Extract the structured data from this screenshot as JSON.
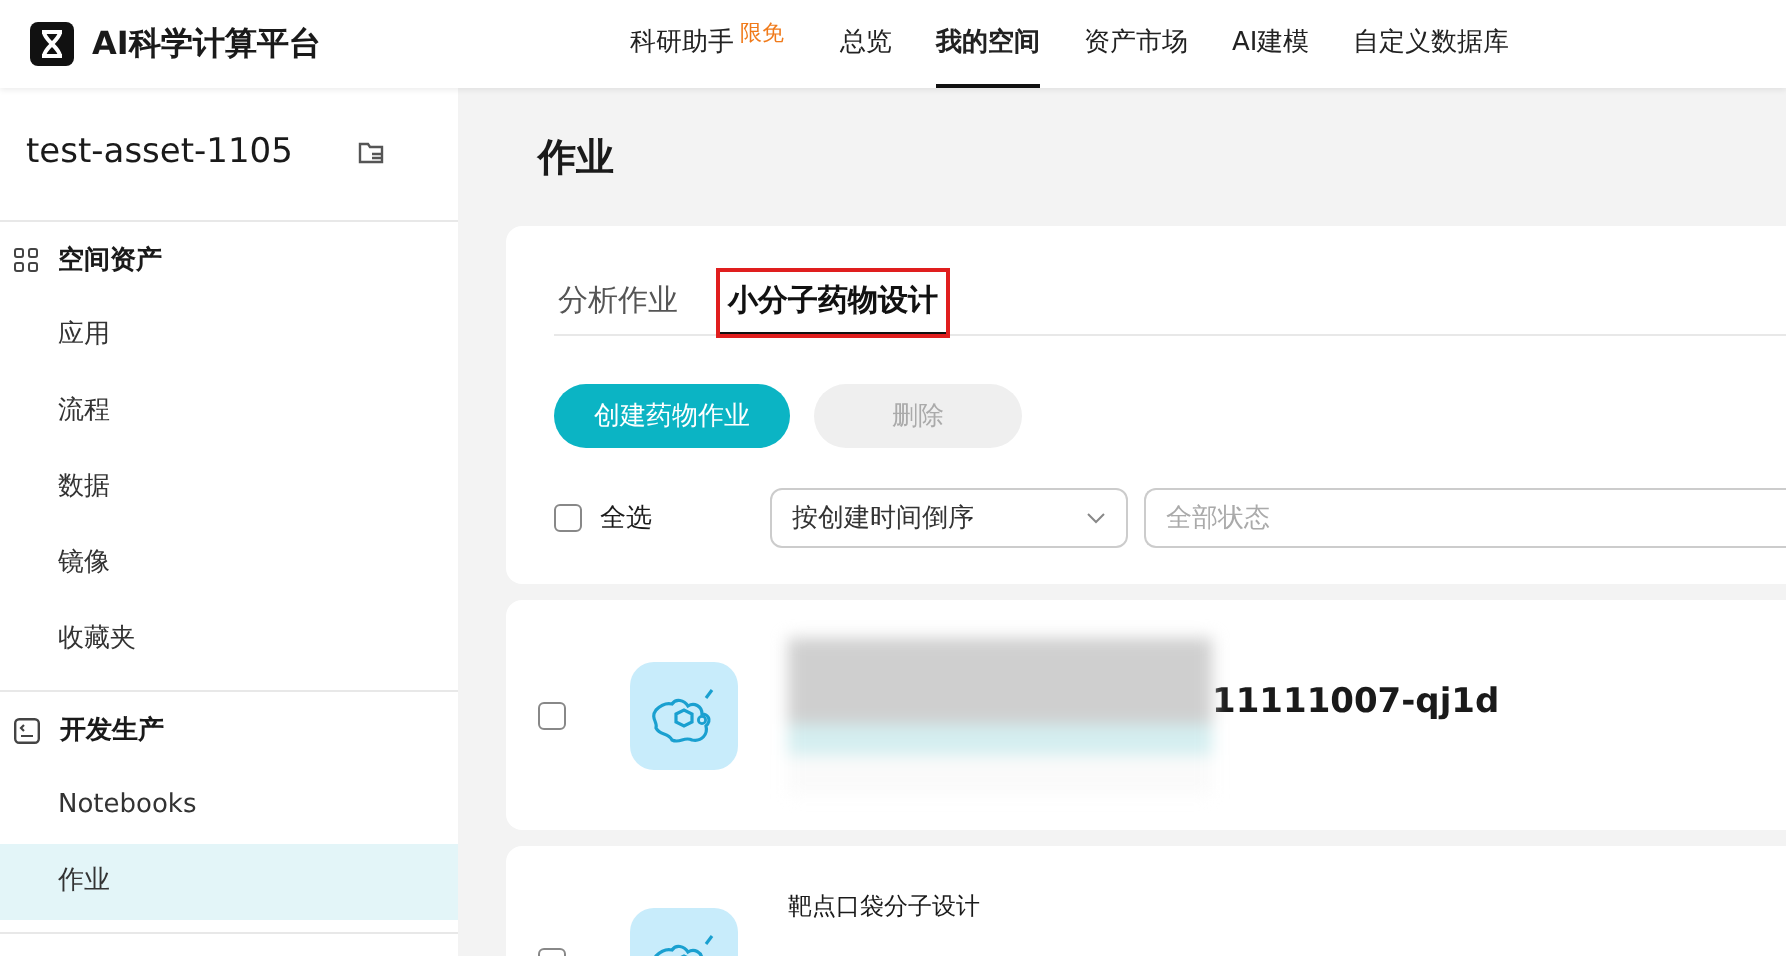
{
  "header": {
    "brand": "AI科学计算平台",
    "nav": [
      {
        "label": "科研助手",
        "badge": "限免",
        "selected": false
      },
      {
        "label": "总览",
        "selected": false
      },
      {
        "label": "我的空间",
        "selected": true
      },
      {
        "label": "资产市场",
        "selected": false
      },
      {
        "label": "AI建模",
        "selected": false
      },
      {
        "label": "自定义数据库",
        "selected": false
      }
    ]
  },
  "sidebar": {
    "workspace": "test-asset-1105",
    "groups": [
      {
        "title": "空间资产",
        "kind": "assets",
        "items": [
          {
            "label": "应用",
            "selected": false
          },
          {
            "label": "流程",
            "selected": false
          },
          {
            "label": "数据",
            "selected": false
          },
          {
            "label": "镜像",
            "selected": false
          },
          {
            "label": "收藏夹",
            "selected": false
          }
        ]
      },
      {
        "title": "开发生产",
        "kind": "development",
        "items": [
          {
            "label": "Notebooks",
            "selected": false
          },
          {
            "label": "作业",
            "selected": true
          }
        ]
      }
    ]
  },
  "page_title": "作业",
  "tabs": [
    {
      "label": "分析作业",
      "selected": false,
      "highlighted": false
    },
    {
      "label": "小分子药物设计",
      "selected": true,
      "highlighted": true
    }
  ],
  "buttons": [
    {
      "label": "创建药物作业",
      "disabled": false
    },
    {
      "label": "删除",
      "disabled": true
    }
  ],
  "select_all": {
    "label": "全选",
    "checked": false
  },
  "sort_select": {
    "value": "按创建时间倒序"
  },
  "status_select": {
    "placeholder": "全部状态"
  },
  "jobs": [
    {
      "title": "11111007-qj1d",
      "redacted": true,
      "checked": false
    },
    {
      "title": "靶点口袋分子设计",
      "redacted": false,
      "checked": false
    }
  ]
}
